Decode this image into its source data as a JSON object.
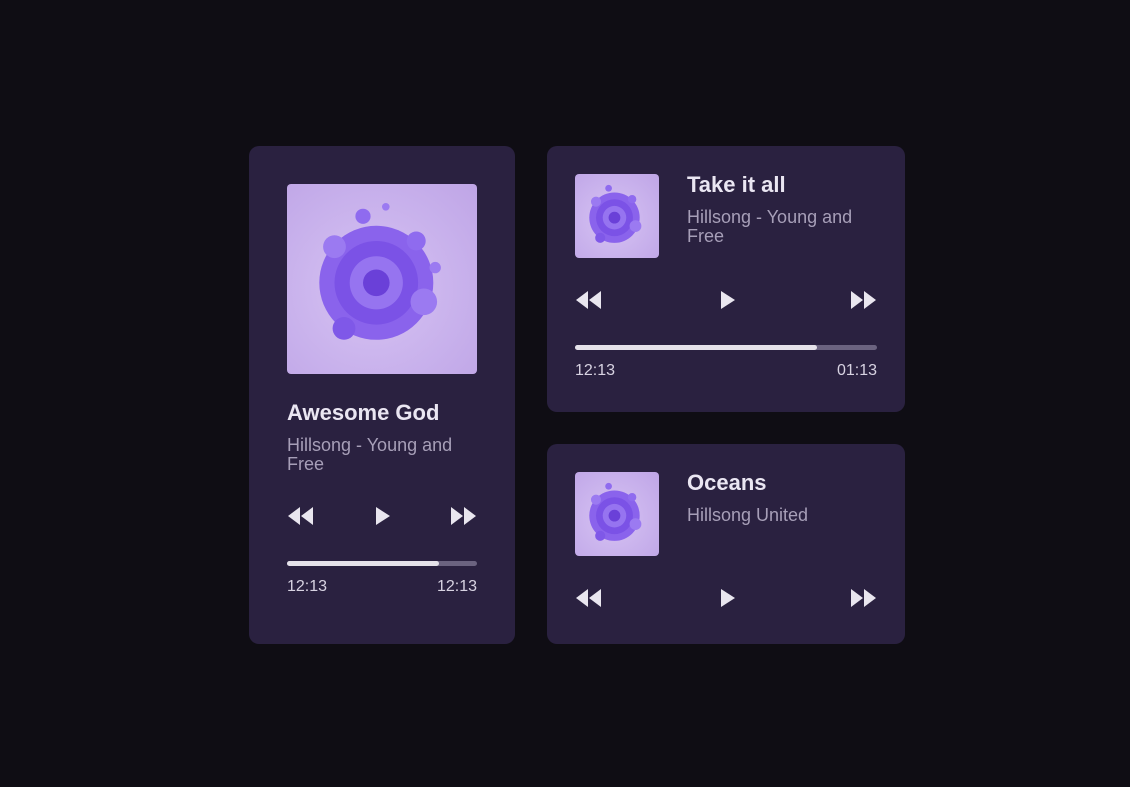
{
  "colors": {
    "background": "#0f0d14",
    "card": "#2a2140",
    "title": "#eae6f2",
    "artist": "#a79fb8",
    "progress_fill": "#e5e2ea",
    "progress_track": "#6b6380",
    "cover_bg": "#c8b1ec",
    "cover_art": "#7b52e6"
  },
  "icons": {
    "cover": "purple-swirl-art-icon",
    "rewind": "rewind-icon",
    "play": "play-icon",
    "forward": "fast-forward-icon"
  },
  "players": [
    {
      "title": "Awesome God",
      "artist": "Hillsong - Young and Free",
      "elapsed": "12:13",
      "duration": "12:13",
      "progress": 0.8
    },
    {
      "title": "Take it all",
      "artist": "Hillsong - Young and Free",
      "elapsed": "12:13",
      "duration": "01:13",
      "progress": 0.8
    },
    {
      "title": "Oceans",
      "artist": "Hillsong United"
    }
  ]
}
